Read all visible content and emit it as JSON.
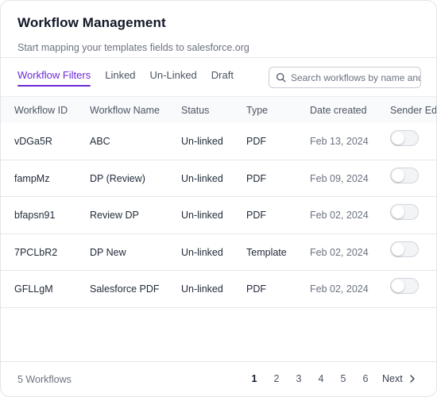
{
  "header": {
    "title": "Workflow Management",
    "subtitle": "Start mapping your templates fields to salesforce.org"
  },
  "tabs": [
    {
      "label": "Workflow Filters",
      "active": true
    },
    {
      "label": "Linked",
      "active": false
    },
    {
      "label": "Un-Linked",
      "active": false
    },
    {
      "label": "Draft",
      "active": false
    }
  ],
  "search": {
    "placeholder": "Search workflows by name and",
    "value": ""
  },
  "table": {
    "columns": [
      "Workflow ID",
      "Workflow Name",
      "Status",
      "Type",
      "Date created",
      "Sender Ed"
    ],
    "rows": [
      {
        "id": "vDGa5R",
        "name": "ABC",
        "status": "Un-linked",
        "type": "PDF",
        "date": "Feb 13, 2024",
        "sender_editable": false
      },
      {
        "id": "fampMz",
        "name": "DP (Review)",
        "status": "Un-linked",
        "type": "PDF",
        "date": "Feb 09, 2024",
        "sender_editable": false
      },
      {
        "id": "bfapsn91",
        "name": "Review DP",
        "status": "Un-linked",
        "type": "PDF",
        "date": "Feb 02, 2024",
        "sender_editable": false
      },
      {
        "id": "7PCLbR2",
        "name": "DP New",
        "status": "Un-linked",
        "type": "Template",
        "date": "Feb 02, 2024",
        "sender_editable": false
      },
      {
        "id": "GFLLgM",
        "name": "Salesforce PDF",
        "status": "Un-linked",
        "type": "PDF",
        "date": "Feb 02, 2024",
        "sender_editable": false
      }
    ]
  },
  "footer": {
    "count_label": "5 Workflows",
    "pages": [
      "1",
      "2",
      "3",
      "4",
      "5",
      "6"
    ],
    "current_page": "1",
    "next_label": "Next"
  },
  "colors": {
    "accent": "#6d28d9",
    "border": "#e5e7eb"
  },
  "icons": {
    "search": "search-icon",
    "next": "chevron-right-icon"
  }
}
